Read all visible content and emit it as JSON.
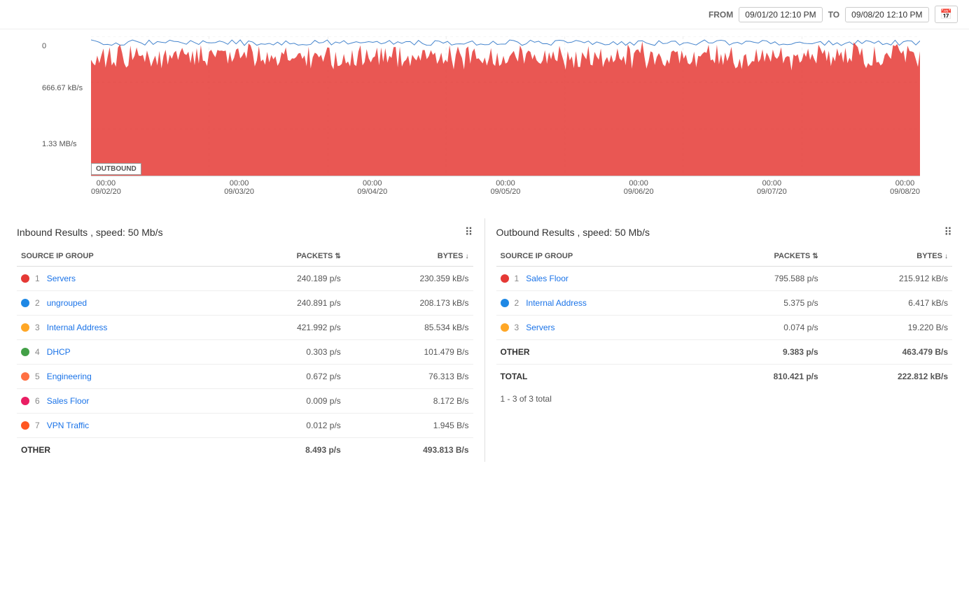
{
  "topbar": {
    "from_label": "FROM",
    "to_label": "TO",
    "from_date": "09/01/20 12:10 PM",
    "to_date": "09/08/20 12:10 PM"
  },
  "chart": {
    "y_labels": [
      "0",
      "666.67 kB/s",
      "1.33 MB/s"
    ],
    "outbound_label": "OUTBOUND",
    "x_ticks": [
      {
        "time": "00:00",
        "date": "09/02/20"
      },
      {
        "time": "00:00",
        "date": "09/03/20"
      },
      {
        "time": "00:00",
        "date": "09/04/20"
      },
      {
        "time": "00:00",
        "date": "09/05/20"
      },
      {
        "time": "00:00",
        "date": "09/06/20"
      },
      {
        "time": "00:00",
        "date": "09/07/20"
      },
      {
        "time": "00:00",
        "date": "09/08/20"
      }
    ]
  },
  "inbound": {
    "title": "Inbound Results , speed: 50 Mb/s",
    "columns": {
      "source": "SOURCE IP GROUP",
      "packets": "PACKETS",
      "bytes": "BYTES"
    },
    "rows": [
      {
        "num": "1",
        "name": "Servers",
        "color": "#e53935",
        "packets": "240.189 p/s",
        "bytes": "230.359 kB/s"
      },
      {
        "num": "2",
        "name": "ungrouped",
        "color": "#1e88e5",
        "packets": "240.891 p/s",
        "bytes": "208.173 kB/s"
      },
      {
        "num": "3",
        "name": "Internal Address",
        "color": "#ffa726",
        "packets": "421.992 p/s",
        "bytes": "85.534 kB/s"
      },
      {
        "num": "4",
        "name": "DHCP",
        "color": "#43a047",
        "packets": "0.303 p/s",
        "bytes": "101.479 B/s"
      },
      {
        "num": "5",
        "name": "Engineering",
        "color": "#ff7043",
        "packets": "0.672 p/s",
        "bytes": "76.313 B/s"
      },
      {
        "num": "6",
        "name": "Sales Floor",
        "color": "#e91e63",
        "packets": "0.009 p/s",
        "bytes": "8.172 B/s"
      },
      {
        "num": "7",
        "name": "VPN Traffic",
        "color": "#ff5722",
        "packets": "0.012 p/s",
        "bytes": "1.945 B/s"
      }
    ],
    "other_label": "OTHER",
    "other_packets": "8.493 p/s",
    "other_bytes": "493.813 B/s"
  },
  "outbound": {
    "title": "Outbound Results , speed: 50 Mb/s",
    "columns": {
      "source": "SOURCE IP GROUP",
      "packets": "PACKETS",
      "bytes": "BYTES"
    },
    "rows": [
      {
        "num": "1",
        "name": "Sales Floor",
        "color": "#e53935",
        "packets": "795.588 p/s",
        "bytes": "215.912 kB/s"
      },
      {
        "num": "2",
        "name": "Internal Address",
        "color": "#1e88e5",
        "packets": "5.375 p/s",
        "bytes": "6.417 kB/s"
      },
      {
        "num": "3",
        "name": "Servers",
        "color": "#ffa726",
        "packets": "0.074 p/s",
        "bytes": "19.220 B/s"
      }
    ],
    "other_label": "OTHER",
    "other_packets": "9.383 p/s",
    "other_bytes": "463.479 B/s",
    "total_label": "TOTAL",
    "total_packets": "810.421 p/s",
    "total_bytes": "222.812 kB/s",
    "pagination": "1 - 3 of 3 total"
  }
}
